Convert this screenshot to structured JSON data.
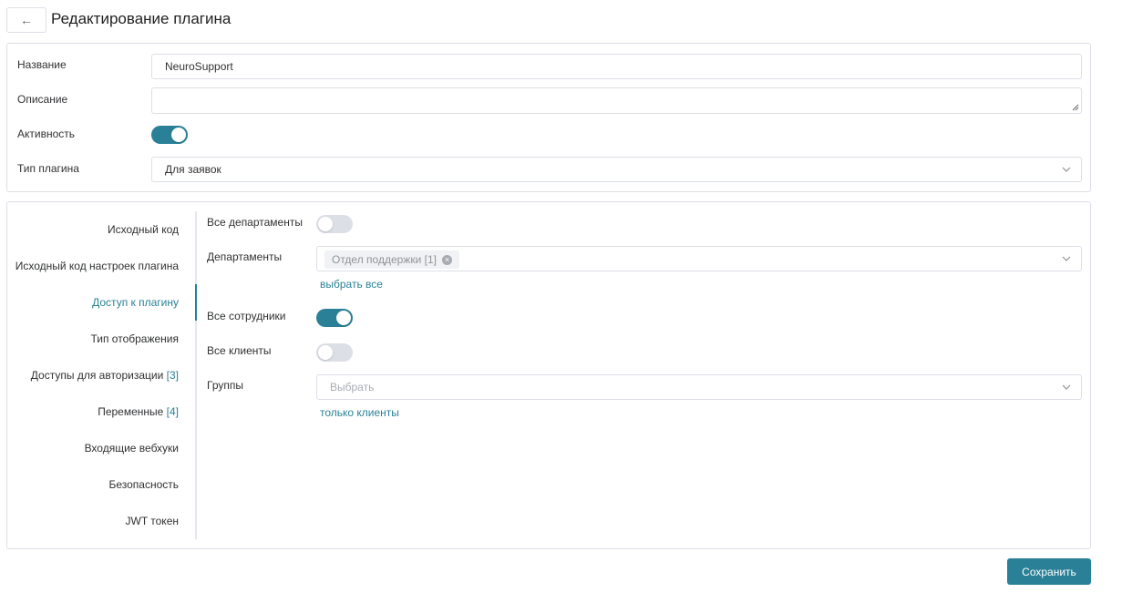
{
  "header": {
    "back_icon": "←",
    "title": "Редактирование плагина"
  },
  "form": {
    "name_label": "Название",
    "name_value": "NeuroSupport",
    "description_label": "Описание",
    "description_value": "",
    "activity_label": "Активность",
    "activity_on": true,
    "plugin_type_label": "Тип плагина",
    "plugin_type_value": "Для заявок"
  },
  "side_menu": {
    "items": [
      {
        "label": "Исходный код",
        "count": ""
      },
      {
        "label": "Исходный код настроек плагина",
        "count": ""
      },
      {
        "label": "Доступ к плагину",
        "count": "",
        "active": true
      },
      {
        "label": "Тип отображения",
        "count": ""
      },
      {
        "label": "Доступы для авторизации",
        "count": "[3]"
      },
      {
        "label": "Переменные",
        "count": "[4]"
      },
      {
        "label": "Входящие вебхуки",
        "count": ""
      },
      {
        "label": "Безопасность",
        "count": ""
      },
      {
        "label": "JWT токен",
        "count": ""
      }
    ]
  },
  "access": {
    "all_departments_label": "Все департаменты",
    "all_departments_on": false,
    "departments_label": "Департаменты",
    "department_tag": "Отдел поддержки [1]",
    "select_all_link": "выбрать все",
    "all_employees_label": "Все сотрудники",
    "all_employees_on": true,
    "all_clients_label": "Все клиенты",
    "all_clients_on": false,
    "groups_label": "Группы",
    "groups_placeholder": "Выбрать",
    "only_clients_link": "только клиенты"
  },
  "footer": {
    "save_label": "Сохранить"
  },
  "colors": {
    "accent": "#2a8197",
    "border": "#dcdfe6",
    "toggle_off": "#dcdfe6"
  }
}
